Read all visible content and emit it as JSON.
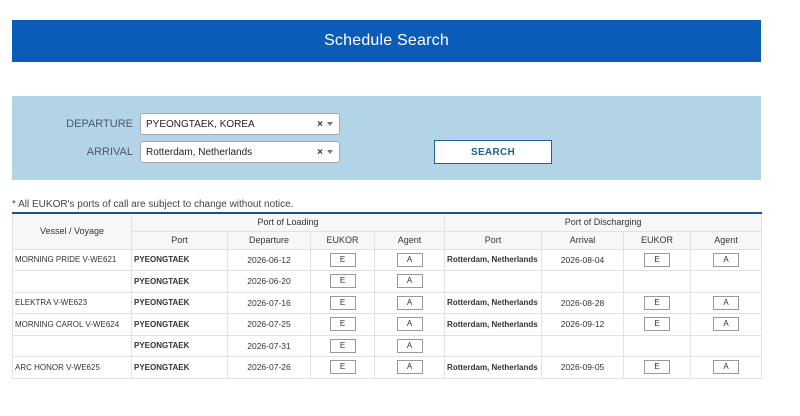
{
  "header": {
    "title": "Schedule Search"
  },
  "search": {
    "departure_label": "DEPARTURE",
    "departure_value": "PYEONGTAEK, KOREA",
    "arrival_label": "ARRIVAL",
    "arrival_value": "Rotterdam, Netherlands",
    "clear_glyph": "×",
    "button_label": "SEARCH"
  },
  "notice": "* All EUKOR's ports of call are subject to change without notice.",
  "table": {
    "col_vessel": "Vessel / Voyage",
    "group_loading": "Port of Loading",
    "group_discharging": "Port of Discharging",
    "sub_headers": [
      "Port",
      "Departure",
      "EUKOR",
      "Agent",
      "Port",
      "Arrival",
      "EUKOR",
      "Agent"
    ],
    "btn_eukor": "E",
    "btn_agent": "A",
    "rows": [
      {
        "vessel": "MORNING PRIDE V-WE621",
        "load_port": "PYEONGTAEK",
        "departure": "2026-06-12",
        "dis_port": "Rotterdam, Netherlands",
        "arrival": "2026-08-04"
      },
      {
        "vessel": "",
        "load_port": "PYEONGTAEK",
        "departure": "2026-06-20",
        "dis_port": "",
        "arrival": ""
      },
      {
        "vessel": "ELEKTRA V-WE623",
        "load_port": "PYEONGTAEK",
        "departure": "2026-07-16",
        "dis_port": "Rotterdam, Netherlands",
        "arrival": "2026-08-28"
      },
      {
        "vessel": "MORNING CAROL V-WE624",
        "load_port": "PYEONGTAEK",
        "departure": "2026-07-25",
        "dis_port": "Rotterdam, Netherlands",
        "arrival": "2026-09-12"
      },
      {
        "vessel": "",
        "load_port": "PYEONGTAEK",
        "departure": "2026-07-31",
        "dis_port": "",
        "arrival": ""
      },
      {
        "vessel": "ARC HONOR V-WE625",
        "load_port": "PYEONGTAEK",
        "departure": "2026-07-26",
        "dis_port": "Rotterdam, Netherlands",
        "arrival": "2026-09-05"
      }
    ]
  }
}
